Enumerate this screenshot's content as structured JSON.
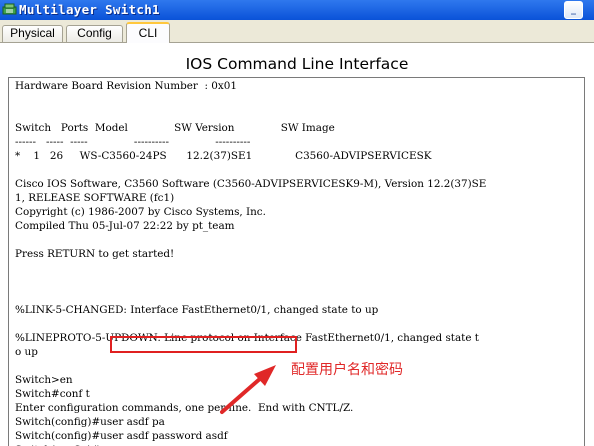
{
  "window": {
    "title": "Multilayer Switch1",
    "minimize_glyph": "_"
  },
  "tabs": [
    {
      "label": "Physical",
      "active": false
    },
    {
      "label": "Config",
      "active": false
    },
    {
      "label": "CLI",
      "active": true
    }
  ],
  "cli": {
    "heading": "IOS Command Line Interface",
    "lines": [
      "Hardware Board Revision Number  : 0x01",
      "",
      "",
      "Switch   Ports  Model              SW Version              SW Image",
      "------   -----  -----              ----------              ----------",
      "*    1   26     WS-C3560-24PS      12.2(37)SE1             C3560-ADVIPSERVICESK",
      "",
      "Cisco IOS Software, C3560 Software (C3560-ADVIPSERVICESK9-M), Version 12.2(37)SE",
      "1, RELEASE SOFTWARE (fc1)",
      "Copyright (c) 1986-2007 by Cisco Systems, Inc.",
      "Compiled Thu 05-Jul-07 22:22 by pt_team",
      "",
      "Press RETURN to get started!",
      "",
      "",
      "",
      "%LINK-5-CHANGED: Interface FastEthernet0/1, changed state to up",
      "",
      "%LINEPROTO-5-UPDOWN: Line protocol on Interface FastEthernet0/1, changed state t",
      "o up",
      "",
      "Switch>en",
      "Switch#conf t",
      "Enter configuration commands, one per line.  End with CNTL/Z.",
      "Switch(config)#user asdf pa",
      "Switch(config)#user asdf password asdf",
      "Switch(config)#"
    ]
  },
  "annotation": {
    "text": "配置用户名和密码",
    "color": "#e02828"
  },
  "colors": {
    "titlebar": "#0a52d8",
    "active_tab_accent": "#ffc73d",
    "annotation": "#e02828"
  }
}
